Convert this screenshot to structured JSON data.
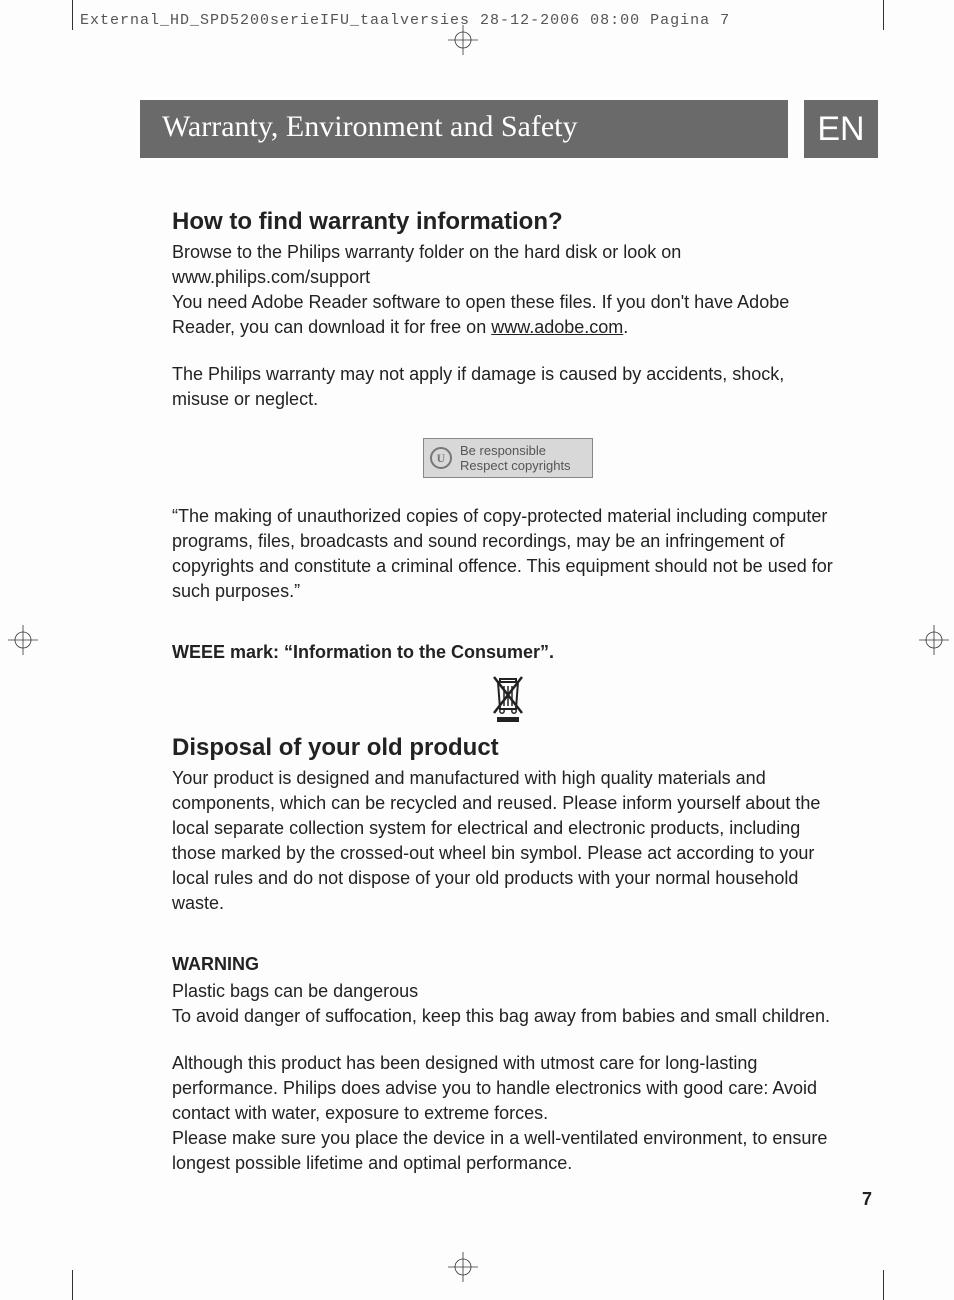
{
  "print_header": "External_HD_SPD5200serieIFU_taalversies  28-12-2006  08:00  Pagina 7",
  "title_bar": "Warranty, Environment and Safety",
  "lang_badge": "EN",
  "h_warranty": "How to find warranty information?",
  "p_browse1": "Browse to the Philips warranty folder on the hard disk or look on www.philips.com/support",
  "p_browse2a": "You need Adobe Reader software to open these files. If you don't have Adobe Reader, you can download it for free on ",
  "adobe_link": "www.adobe.com",
  "p_browse2b": ".",
  "p_warranty_limit": "The Philips warranty may not apply if damage is caused by accidents, shock, misuse or neglect.",
  "copyright_line1": "Be responsible",
  "copyright_line2": "Respect copyrights",
  "p_copy_quote": "“The making of unauthorized copies of copy-protected material including computer programs, files, broadcasts and sound recordings, may be an infringement of copyrights and constitute a criminal offence. This equipment should not be used for such purposes.”",
  "h_weee": "WEEE mark: “Information to the Consumer”.",
  "h_disposal": "Disposal of your old product",
  "p_disposal": "Your product is designed and manufactured with high quality materials and components, which can be recycled and reused. Please inform yourself about the local separate collection system for electrical and electronic products, including those marked by the crossed-out wheel bin symbol. Please act according to your local rules and do not dispose of your old products with your normal household waste.",
  "h_warning": "WARNING",
  "p_warn1": "Plastic bags can be dangerous",
  "p_warn2": "To avoid danger of suffocation, keep this bag away from babies and small children.",
  "p_warn3": "Although this product has been designed with utmost care for long-lasting performance. Philips does advise you to handle electronics with good care:  Avoid contact with water, exposure to extreme forces.",
  "p_warn4": "Please make sure you place the device in a well-ventilated environment, to ensure longest possible lifetime and optimal performance.",
  "page_number": "7"
}
